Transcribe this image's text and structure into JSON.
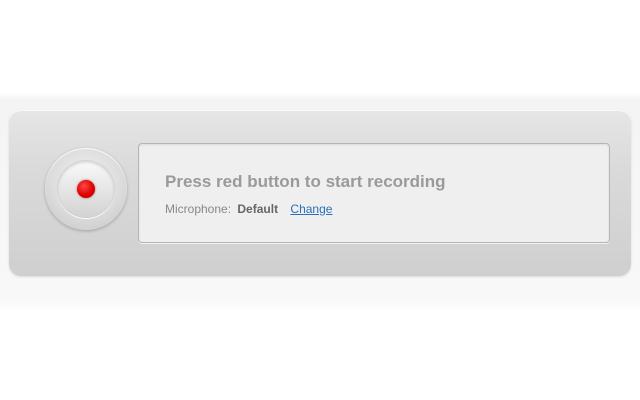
{
  "recorder": {
    "record_button": {
      "icon": "record-dot-icon",
      "dot_color": "#e00000"
    },
    "status": {
      "title": "Press red button to start recording",
      "microphone_label": "Microphone:",
      "microphone_value": "Default",
      "change_link": "Change"
    }
  }
}
